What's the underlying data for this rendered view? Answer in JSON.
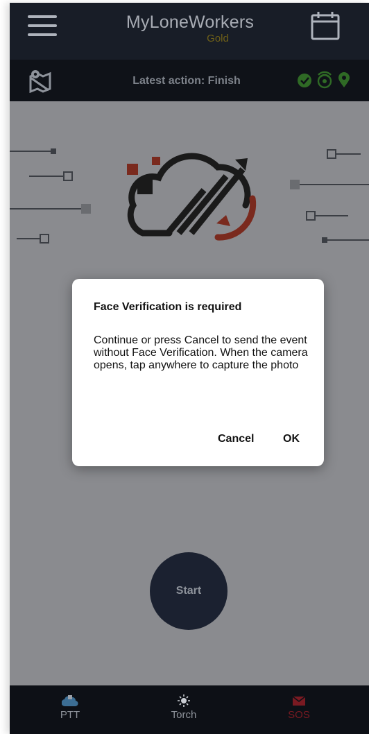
{
  "header": {
    "title": "MyLoneWorkers",
    "subtitle": "Gold"
  },
  "statusbar": {
    "latest_action": "Latest action: Finish",
    "icons": [
      "check-circle-icon",
      "broadcast-icon",
      "location-pin-icon"
    ]
  },
  "main": {
    "start_label": "Start"
  },
  "dialog": {
    "title": "Face Verification is required",
    "message": "Continue or press Cancel to send the event without Face Verification. When the camera opens, tap anywhere to capture the photo",
    "cancel_label": "Cancel",
    "ok_label": "OK"
  },
  "bottom_nav": {
    "items": [
      {
        "label": "PTT",
        "icon": "cloud-icon"
      },
      {
        "label": "Torch",
        "icon": "sun-icon"
      },
      {
        "label": "SOS",
        "icon": "envelope-icon"
      }
    ]
  },
  "colors": {
    "header_bg": "#181d27",
    "overlay_bg": "#8a8b8f",
    "gold": "#6f6018",
    "sos_red": "#7a1a22",
    "status_green": "#2f6a25",
    "logo_red": "#7a2a1e"
  }
}
